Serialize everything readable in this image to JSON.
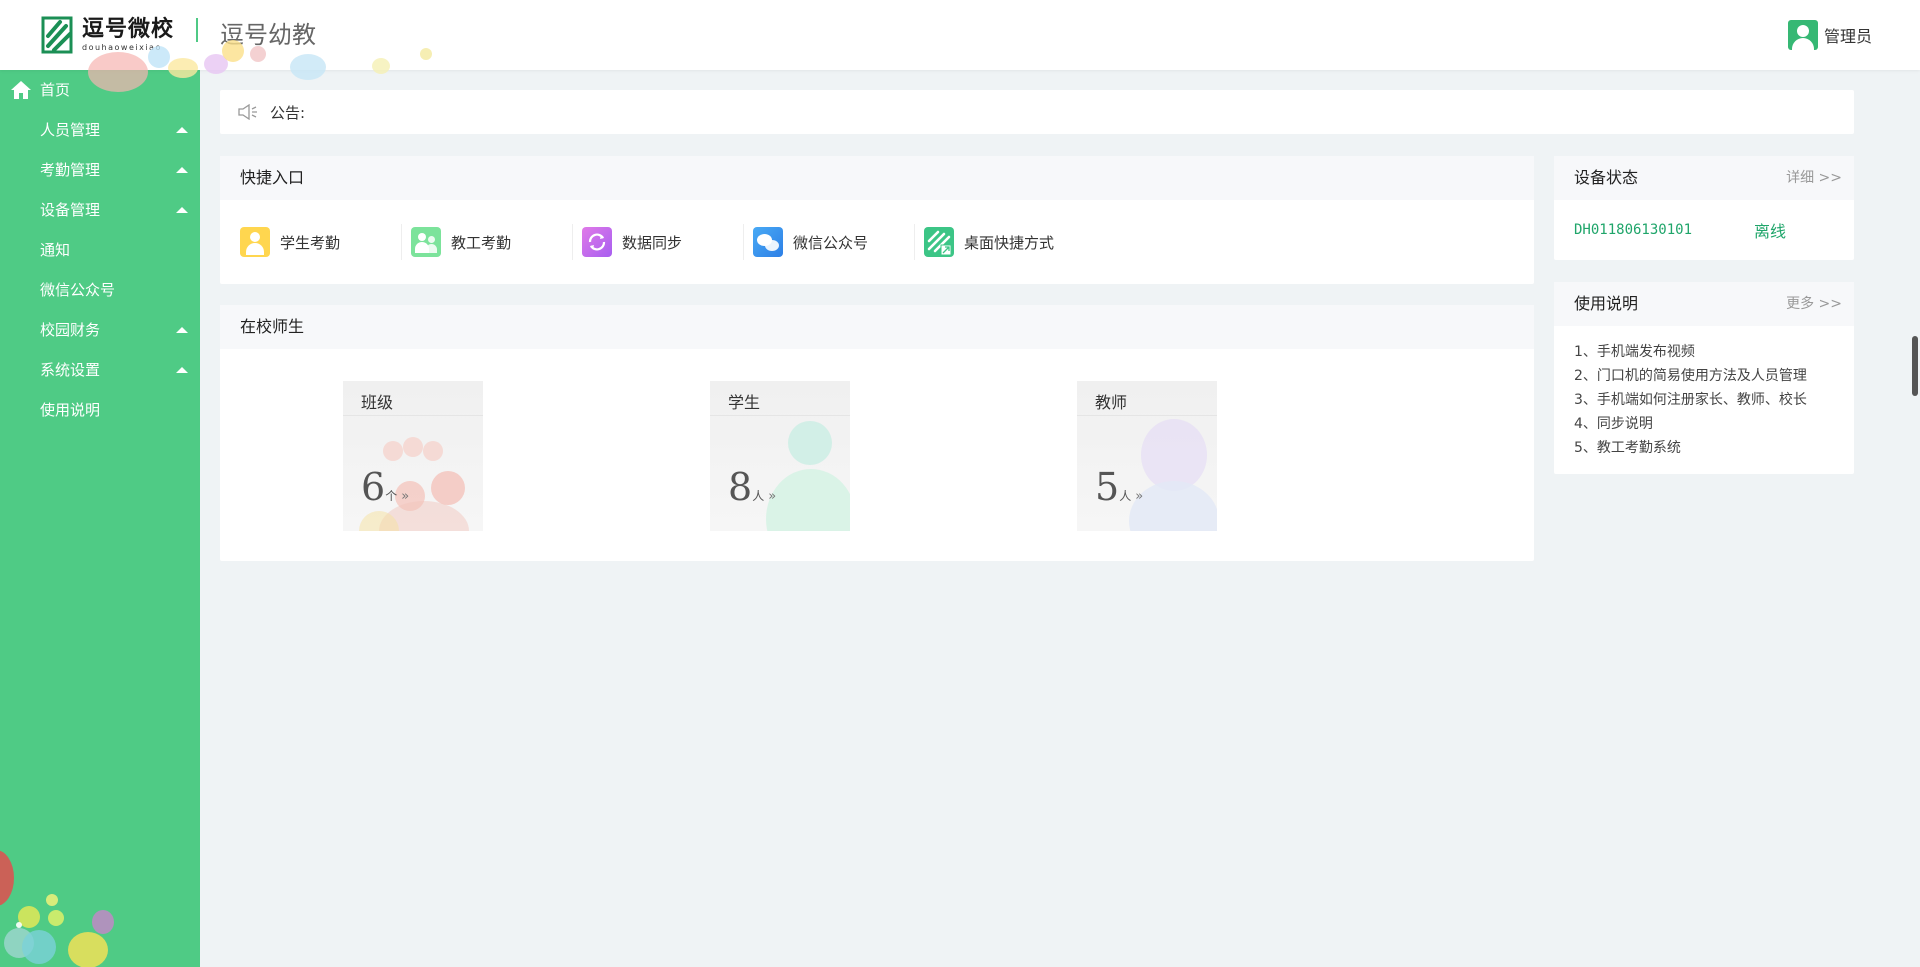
{
  "header": {
    "logo_cn": "逗号微校",
    "logo_pinyin": "douhaoweixiao",
    "app_title": "逗号幼教",
    "user_name": "管理员"
  },
  "sidebar": {
    "items": [
      {
        "label": "首页",
        "icon": "home-icon",
        "expandable": false
      },
      {
        "label": "人员管理",
        "expandable": true
      },
      {
        "label": "考勤管理",
        "expandable": true
      },
      {
        "label": "设备管理",
        "expandable": true
      },
      {
        "label": "通知",
        "expandable": false
      },
      {
        "label": "微信公众号",
        "expandable": false
      },
      {
        "label": "校园财务",
        "expandable": true
      },
      {
        "label": "系统设置",
        "expandable": true
      },
      {
        "label": "使用说明",
        "expandable": false
      }
    ]
  },
  "notice": {
    "label": "公告:",
    "icon": "speaker-icon"
  },
  "quick": {
    "title": "快捷入口",
    "items": [
      {
        "label": "学生考勤",
        "icon": "student-attendance-icon",
        "color": "#ffd64f"
      },
      {
        "label": "教工考勤",
        "icon": "staff-attendance-icon",
        "color": "#7ce39b"
      },
      {
        "label": "数据同步",
        "icon": "sync-icon",
        "color": "#c86bf0"
      },
      {
        "label": "微信公众号",
        "icon": "wechat-icon",
        "color": "#3a9bf0"
      },
      {
        "label": "桌面快捷方式",
        "icon": "desktop-shortcut-icon",
        "color": "#3cc586"
      }
    ]
  },
  "school": {
    "title": "在校师生",
    "cards": [
      {
        "title": "班级",
        "count": "6",
        "unit": "个",
        "arrow": "»"
      },
      {
        "title": "学生",
        "count": "8",
        "unit": "人",
        "arrow": "»"
      },
      {
        "title": "教师",
        "count": "5",
        "unit": "人",
        "arrow": "»"
      }
    ]
  },
  "device": {
    "title": "设备状态",
    "more": "详细 >>",
    "id": "DH011806130101",
    "status": "离线"
  },
  "usage": {
    "title": "使用说明",
    "more": "更多 >>",
    "items": [
      "1、手机端发布视频",
      "2、门口机的简易使用方法及人员管理",
      "3、手机端如何注册家长、教师、校长",
      "4、同步说明",
      "5、教工考勤系统"
    ]
  },
  "colors": {
    "sidebar_bg": "#4fcb85",
    "accent": "#1fa56a",
    "page_bg": "#eff3f5"
  }
}
